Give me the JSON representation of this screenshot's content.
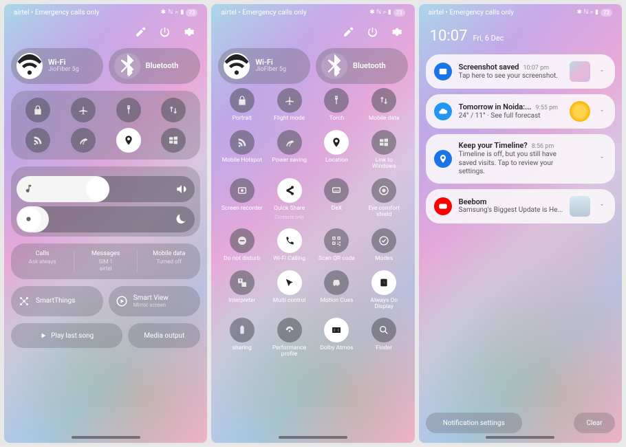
{
  "status": {
    "carrier": "airtel • Emergency calls only",
    "battery": "73"
  },
  "panel1": {
    "wifi": {
      "title": "Wi-Fi",
      "sub": "JioFiber 5g"
    },
    "bluetooth": {
      "title": "Bluetooth"
    },
    "sim": {
      "calls": {
        "label": "Calls",
        "value": "Ask always"
      },
      "messages": {
        "label": "Messages",
        "value1": "SIM 1",
        "value2": "airtel"
      },
      "mobiledata": {
        "label": "Mobile data",
        "value": "Turned off"
      }
    },
    "smartthings": "SmartThings",
    "smartview": {
      "title": "Smart View",
      "sub": "Mirror screen"
    },
    "playlast": "Play last song",
    "mediaout": "Media output"
  },
  "panel2": {
    "wifi": {
      "title": "Wi-Fi",
      "sub": "JioFiber 5g"
    },
    "bluetooth": {
      "title": "Bluetooth"
    },
    "tiles": [
      {
        "key": "portrait",
        "label": "Portrait"
      },
      {
        "key": "flight",
        "label": "Flight mode"
      },
      {
        "key": "torch",
        "label": "Torch"
      },
      {
        "key": "mobiledata",
        "label": "Mobile data"
      },
      {
        "key": "hotspot",
        "label": "Mobile Hotspot"
      },
      {
        "key": "powersave",
        "label": "Power saving"
      },
      {
        "key": "location",
        "label": "Location",
        "active": true
      },
      {
        "key": "link",
        "label": "Link to Windows"
      },
      {
        "key": "recorder",
        "label": "Screen recorder"
      },
      {
        "key": "quickshare",
        "label": "Quick Share",
        "sub": "Contacts only",
        "active": true
      },
      {
        "key": "dex",
        "label": "DeX"
      },
      {
        "key": "eyecomfort",
        "label": "Eye comfort shield"
      },
      {
        "key": "dnd",
        "label": "Do not disturb"
      },
      {
        "key": "wificalling",
        "label": "Wi-Fi Calling",
        "active": true
      },
      {
        "key": "qr",
        "label": "Scan QR code"
      },
      {
        "key": "modes",
        "label": "Modes"
      },
      {
        "key": "interpreter",
        "label": "Interpreter"
      },
      {
        "key": "multicontrol",
        "label": "Multi control",
        "active": true
      },
      {
        "key": "motioncues",
        "label": "Motion Cues"
      },
      {
        "key": "aod",
        "label": "Always On Display",
        "active": true
      },
      {
        "key": "sharing",
        "label": "sharing"
      },
      {
        "key": "perf",
        "label": "Performance profile"
      },
      {
        "key": "dolby",
        "label": "Dolby Atmos",
        "active": true
      },
      {
        "key": "finder",
        "label": "Finder"
      }
    ]
  },
  "panel3": {
    "clock": "10:07",
    "date": "Fri, 6 Dec",
    "notifs": [
      {
        "app": "gallery",
        "color": "#1a73e8",
        "title": "Screenshot saved",
        "time": "10:07 pm",
        "sub": "Tap here to see your screenshot.",
        "thumb": "gradient"
      },
      {
        "app": "weather",
        "color": "#2196f3",
        "title": "Tomorrow in Noida:...",
        "time": "9:55 pm",
        "sub": "24° / 11° · See full forecast",
        "thumb": "sun"
      },
      {
        "app": "maps",
        "color": "#1a73e8",
        "title": "Keep your Timeline?",
        "time": "8:56 pm",
        "sub": "Timeline is off, but you still have saved visits. Tap to review your settings."
      },
      {
        "app": "youtube",
        "color": "#ff0000",
        "title": "Beebom",
        "sub": "Samsung's Biggest Update is He...",
        "thumb": "person"
      }
    ],
    "notif_settings": "Notification settings",
    "clear": "Clear"
  }
}
